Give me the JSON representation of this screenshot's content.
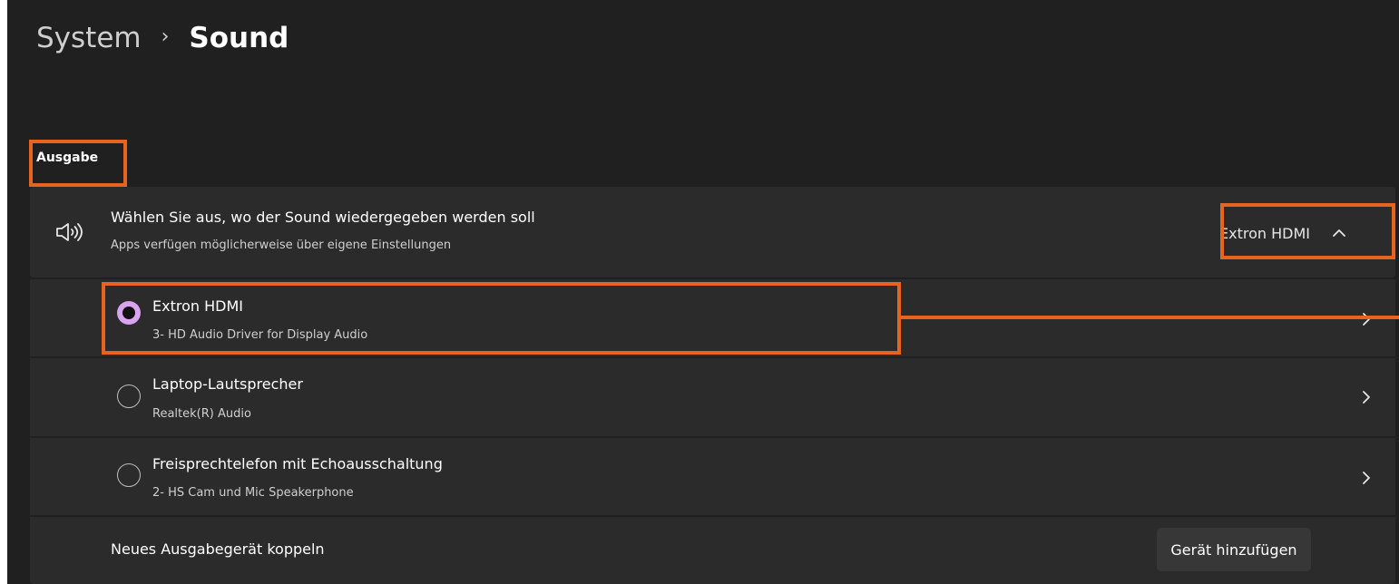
{
  "breadcrumb": {
    "parent": "System",
    "separator": "›",
    "current": "Sound"
  },
  "output": {
    "section_title": "Ausgabe",
    "selector": {
      "title": "Wählen Sie aus, wo der Sound wiedergegeben werden soll",
      "subtitle": "Apps verfügen möglicherweise über eigene Einstellungen",
      "selected_value": "Extron HDMI",
      "icon": "speaker-icon",
      "expand_icon": "chevron-up-icon"
    },
    "devices": [
      {
        "name": "Extron HDMI",
        "driver": "3- HD Audio Driver for Display Audio",
        "selected": true
      },
      {
        "name": "Laptop-Lautsprecher",
        "driver": "Realtek(R) Audio",
        "selected": false
      },
      {
        "name": "Freisprechtelefon mit Echoausschaltung",
        "driver": "2- HS Cam und Mic Speakerphone",
        "selected": false
      }
    ],
    "pair": {
      "label": "Neues Ausgabegerät koppeln",
      "button_label": "Gerät hinzufügen"
    }
  },
  "colors": {
    "background": "#202020",
    "card": "#2b2b2b",
    "accent_radio": "#d8a4f0",
    "highlight": "#e8641e"
  }
}
